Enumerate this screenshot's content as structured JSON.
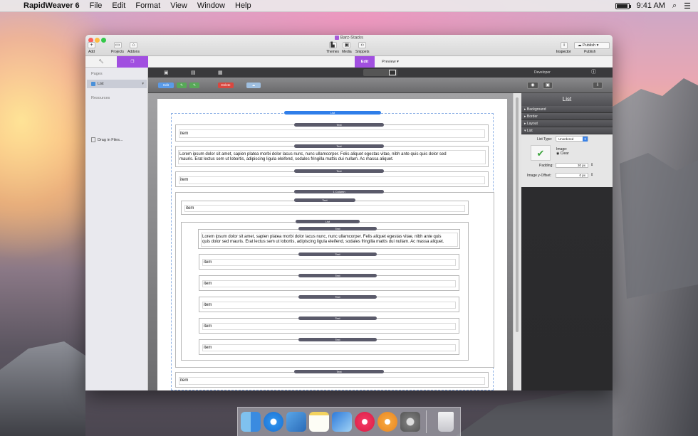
{
  "menubar": {
    "app_name": "RapidWeaver 6",
    "menus": [
      "File",
      "Edit",
      "Format",
      "View",
      "Window",
      "Help"
    ],
    "time": "9:41 AM"
  },
  "window": {
    "title": "Barz-Stacks",
    "left_tools": [
      {
        "label": "Add",
        "icon": "plus-icon"
      },
      {
        "label": "Projects",
        "icon": "projects-icon"
      },
      {
        "label": "Addons",
        "icon": "addons-icon"
      }
    ],
    "center_tools": [
      {
        "label": "Themes",
        "icon": "themes-icon"
      },
      {
        "label": "Media",
        "icon": "media-icon"
      },
      {
        "label": "Snippets",
        "icon": "snippets-icon"
      }
    ],
    "inspector_label": "Inspector",
    "publish_button": "Publish",
    "publish_label": "Publish",
    "modes": {
      "edit": "Edit",
      "preview": "Preview"
    }
  },
  "sidebar": {
    "pages_header": "Pages",
    "selected_page": "List",
    "resources_header": "Resources",
    "drag_in": "Drag in Files..."
  },
  "editor": {
    "edit_btn": "Edit",
    "delete_btn": "Delete"
  },
  "canvas": {
    "labels": {
      "list": "List",
      "text": "Text",
      "one_column": "1 Column"
    },
    "item": "item",
    "lorem": "Lorem ipsum dolor sit amet, sapien platea morbi dolor lacus nunc, nunc ullamcorper. Felis aliquet egestas vitae, nibh ante quis quis dolor sed mauris. Erat lectus sem ut lobortis, adipiscing ligula eleifend, sodales fringilla mattis dui nullam. Ac massa aliquet.",
    "lorem_line1": "Lorem ipsum dolor sit amet, sapien platea morbi dolor lacus nunc, nunc ullamcorper. Felis aliquet egestas vitae, nibh ante quis quis dolor sed",
    "lorem_line2": "mauris. Erat lectus sem ut lobortis, adipiscing ligula eleifend, sodales fringilla mattis dui nullam. Ac massa aliquet.",
    "lorem_inner1": "Lorem ipsum dolor sit amet, sapien platea morbi dolor lacus nunc, nunc ullamcorper. Felis aliquet egestas vitae, nibh ante quis",
    "lorem_inner2": "quis dolor sed mauris. Erat lectus sem ut lobortis, adipiscing ligula eleifend, sodales fringilla mattis dui nullam. Ac massa aliquet."
  },
  "inspector": {
    "top_label": "Developer",
    "title": "List",
    "sections": [
      "Background",
      "Border",
      "Layout",
      "List"
    ],
    "list_type_label": "List Type:",
    "list_type_value": "Unordered",
    "image_label": "Image:",
    "clear_label": "Clear",
    "padding_label": "Padding:",
    "padding_value": "30 px",
    "offset_label": "Image y-Offset:",
    "offset_value": "0 px"
  },
  "dock": [
    "Finder",
    "Safari",
    "Mail",
    "Notes",
    "Xcode",
    "iTunes",
    "iBooks",
    "System Preferences",
    "Trash"
  ],
  "colors": {
    "accent_purple": "#a14fe0",
    "pill_blue": "#2f7ee9",
    "pill_dark": "#5a5a6a",
    "delete_red": "#d9473f"
  }
}
